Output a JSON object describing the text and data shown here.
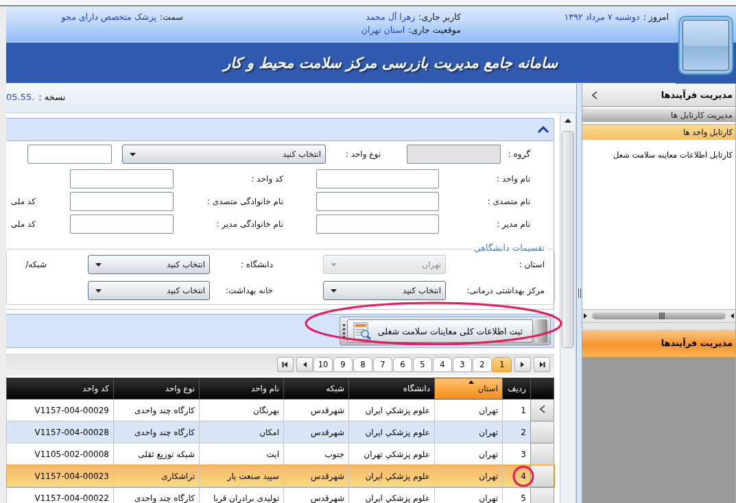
{
  "header": {
    "today_label": "امروز :",
    "today": "دوشنبه ۷ مرداد ۱۳۹۲",
    "user_label": "کاربر جاری:",
    "user": "زهرا آل محمد",
    "location_label": "موقعیت جاری:",
    "location": "استان تهران",
    "role_label": "سمت:",
    "role": "پزشک  متخصص دارای مجو"
  },
  "banner_title": "سامانه جامع مدیریت بازرسی مرکز سلامت محیط و کار",
  "version": {
    "label": "نسخه :",
    "value": ".05.55"
  },
  "form": {
    "expanded": true,
    "rows": [
      [
        {
          "kind": "label",
          "text": "گروه :"
        },
        {
          "kind": "input",
          "disabled": true
        },
        {
          "kind": "label",
          "text": "نوع واحد :"
        },
        {
          "kind": "select",
          "value": "انتخاب کنید",
          "disabled": false
        },
        {
          "kind": "input",
          "disabled": false
        }
      ],
      [
        {
          "kind": "label",
          "text": "نام واحد :"
        },
        {
          "kind": "input",
          "disabled": false
        },
        {
          "kind": "label",
          "text": "کد واحد :"
        },
        {
          "kind": "input",
          "disabled": false
        }
      ],
      [
        {
          "kind": "label",
          "text": "نام متصدی :"
        },
        {
          "kind": "input",
          "disabled": false
        },
        {
          "kind": "label",
          "text": "نام خانوادگی متصدی :"
        },
        {
          "kind": "input",
          "disabled": false
        },
        {
          "kind": "label",
          "text": "کد ملی"
        }
      ],
      [
        {
          "kind": "label",
          "text": "نام مدیر :"
        },
        {
          "kind": "input",
          "disabled": false
        },
        {
          "kind": "label",
          "text": "نام خانوادگی مدیر :"
        },
        {
          "kind": "input",
          "disabled": false
        },
        {
          "kind": "label",
          "text": "کد ملی"
        }
      ]
    ],
    "fieldset": {
      "legend": "تقسیمات دانشگاهی",
      "rows": [
        [
          {
            "kind": "label",
            "text": "استان :"
          },
          {
            "kind": "select",
            "value": "تهران",
            "disabled": true
          },
          {
            "kind": "label",
            "text": "دانشگاه :"
          },
          {
            "kind": "select",
            "value": "انتخاب کنید",
            "disabled": false
          },
          {
            "kind": "label",
            "text": "شبکه/"
          }
        ],
        [
          {
            "kind": "label",
            "text": "مرکز بهداشتی درمانی:"
          },
          {
            "kind": "select",
            "value": "انتخاب کنید",
            "disabled": false
          },
          {
            "kind": "label",
            "text": "خانه بهداشت:"
          },
          {
            "kind": "select",
            "value": "انتخاب کنید",
            "disabled": false
          }
        ]
      ]
    }
  },
  "toolbar": {
    "button": "ثبت اطلاعات کلی معاینات سلامت شغلی"
  },
  "pager": {
    "pages": [
      {
        "label": "1",
        "selected": true
      },
      {
        "label": "2",
        "selected": false
      },
      {
        "label": "3",
        "selected": false
      },
      {
        "label": "4",
        "selected": false
      },
      {
        "label": "5",
        "selected": false
      },
      {
        "label": "6",
        "selected": false
      },
      {
        "label": "7",
        "selected": false
      },
      {
        "label": "8",
        "selected": false
      },
      {
        "label": "9",
        "selected": false
      },
      {
        "label": "10",
        "selected": false
      }
    ]
  },
  "grid": {
    "columns": [
      {
        "label": "ردیف",
        "sorted": false
      },
      {
        "label": "استان",
        "sorted": true
      },
      {
        "label": "دانشگاه",
        "sorted": false
      },
      {
        "label": "شبکه",
        "sorted": false
      },
      {
        "label": "نام واحد",
        "sorted": false
      },
      {
        "label": "نوع واحد",
        "sorted": false
      },
      {
        "label": "کد واحد",
        "sorted": false
      }
    ],
    "rows": [
      {
        "cells": [
          "1",
          "تهران",
          "علوم پزشکي ايران",
          "شهرقدس",
          "بهرنگان",
          "کارگاه چند واحدی",
          "V1157-004-00029"
        ],
        "current": true,
        "selected": false,
        "highlighted": false
      },
      {
        "cells": [
          "2",
          "تهران",
          "علوم پزشکي ايران",
          "شهرقدس",
          "امکان",
          "کارگاه چند واحدی",
          "V1157-004-00028"
        ],
        "current": false,
        "selected": false,
        "highlighted": true
      },
      {
        "cells": [
          "3",
          "تهران",
          "علوم پزشکي تهران",
          "جنوب",
          "ايت",
          "شبکه توزیع ثقلی",
          "V1105-002-00008"
        ],
        "current": false,
        "selected": false,
        "highlighted": false
      },
      {
        "cells": [
          "4",
          "تهران",
          "علوم پزشکي ايران",
          "شهرقدس",
          "سپید صنعت یار",
          "تراشکاری",
          "V1157-004-00023"
        ],
        "current": false,
        "selected": true,
        "highlighted": false
      },
      {
        "cells": [
          "5",
          "تهران",
          "علوم پزشکي ايران",
          "شهرقدس",
          "تولیدی برادران قربا",
          "کارگاه چند واحدی",
          "V1157-004-00022"
        ],
        "current": false,
        "selected": false,
        "highlighted": false
      }
    ]
  },
  "side_panel": {
    "title": "مدیریت فرآیندها",
    "group": "مدیریت کارتابل ها",
    "items": [
      {
        "label": "کارتابل واحد ها",
        "selected": true
      },
      {
        "label": "کارتابل اطلاعات معاینه سلامت شغل",
        "selected": false
      }
    ],
    "footer_title": "مدیریت فرآیندها"
  }
}
